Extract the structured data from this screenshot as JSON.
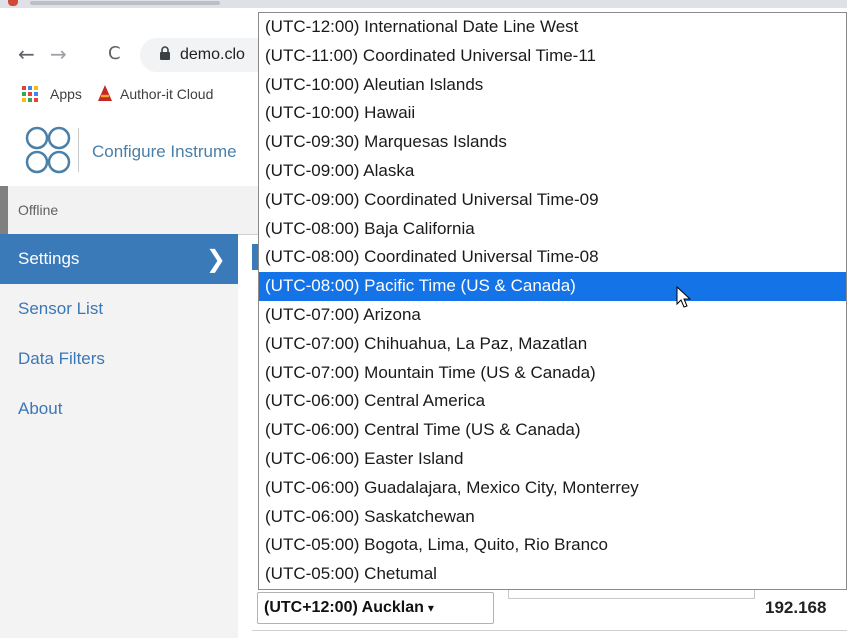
{
  "browser": {
    "url": "demo.clo",
    "nav": {
      "back": "←",
      "forward": "→",
      "reload": "C"
    },
    "bookmarks": [
      {
        "label": "Apps",
        "icon": "apps-grid-icon"
      },
      {
        "label": "Author-it Cloud",
        "icon": "author-it-logo-icon"
      }
    ]
  },
  "app": {
    "title": "Configure Instrume",
    "status": "Offline",
    "sidebar": {
      "items": [
        {
          "label": "Settings",
          "active": true,
          "chevron": "❯"
        },
        {
          "label": "Sensor List",
          "active": false
        },
        {
          "label": "Data Filters",
          "active": false
        },
        {
          "label": "About",
          "active": false
        }
      ]
    },
    "content": {
      "timezone_select_value": "(UTC+12:00) Aucklan",
      "timezone_select_arrow": "▾",
      "ip_partial": "192.168"
    }
  },
  "dropdown": {
    "selected_index": 9,
    "options": [
      "(UTC-12:00) International Date Line West",
      "(UTC-11:00) Coordinated Universal Time-11",
      "(UTC-10:00) Aleutian Islands",
      "(UTC-10:00) Hawaii",
      "(UTC-09:30) Marquesas Islands",
      "(UTC-09:00) Alaska",
      "(UTC-09:00) Coordinated Universal Time-09",
      "(UTC-08:00) Baja California",
      "(UTC-08:00) Coordinated Universal Time-08",
      "(UTC-08:00) Pacific Time (US & Canada)",
      "(UTC-07:00) Arizona",
      "(UTC-07:00) Chihuahua, La Paz, Mazatlan",
      "(UTC-07:00) Mountain Time (US & Canada)",
      "(UTC-06:00) Central America",
      "(UTC-06:00) Central Time (US & Canada)",
      "(UTC-06:00) Easter Island",
      "(UTC-06:00) Guadalajara, Mexico City, Monterrey",
      "(UTC-06:00) Saskatchewan",
      "(UTC-05:00) Bogota, Lima, Quito, Rio Branco",
      "(UTC-05:00) Chetumal"
    ]
  },
  "colors": {
    "accent": "#3b7ab8",
    "selection": "#1473e6",
    "link": "#3c77b5"
  }
}
